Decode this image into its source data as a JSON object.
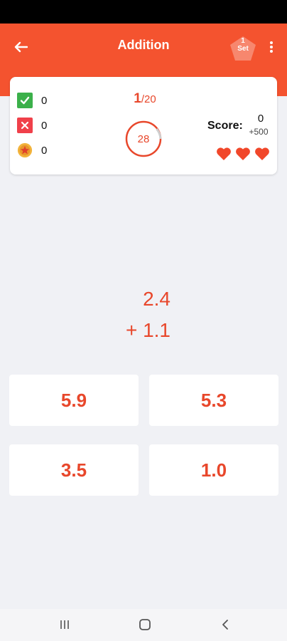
{
  "app_bar": {
    "title": "Addition",
    "set_number": "1",
    "set_label": "Set",
    "color": "#f4532f"
  },
  "stats": {
    "correct": "0",
    "wrong": "0",
    "coins": "0",
    "question_current": "1",
    "question_total": "/20",
    "timer": "28",
    "score_label": "Score:",
    "score": "0",
    "score_bonus": "+500",
    "lives": 3
  },
  "problem": {
    "first_operand": "2.4",
    "second_operand": "+ 1.1"
  },
  "answers": [
    {
      "label": "5.9"
    },
    {
      "label": "5.3"
    },
    {
      "label": "3.5"
    },
    {
      "label": "1.0"
    }
  ],
  "icons": {
    "back": "arrow-left-icon",
    "menu": "more-vertical-icon",
    "set": "pentagon-badge-icon",
    "correct": "check-icon",
    "wrong": "x-icon",
    "coin": "coin-star-icon",
    "life": "heart-icon",
    "nav_recent": "recent-apps-icon",
    "nav_home": "home-icon",
    "nav_back": "chevron-left-icon"
  },
  "colors": {
    "accent": "#e8472b",
    "correct": "#3bb04a",
    "wrong": "#f0404a",
    "heart": "#f1472a"
  }
}
